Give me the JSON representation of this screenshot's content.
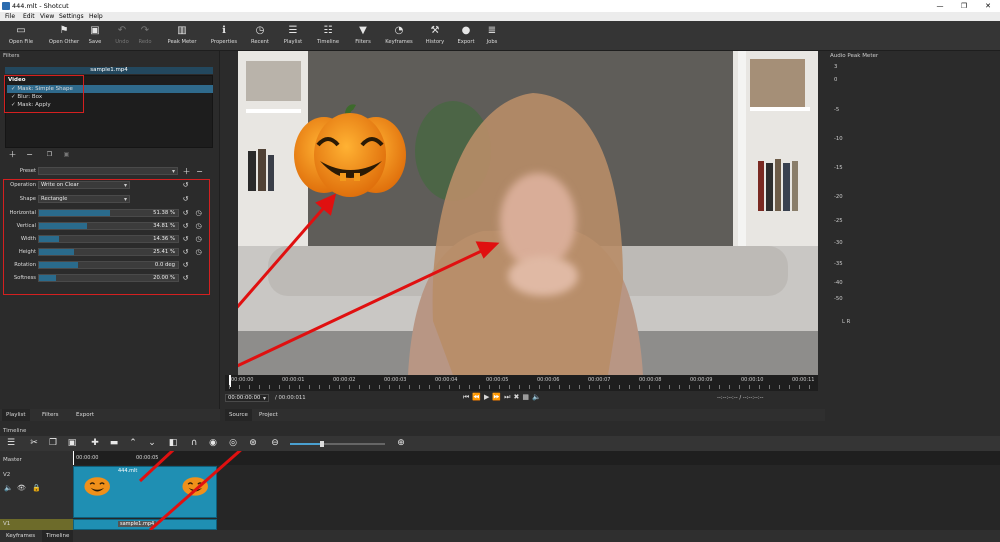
{
  "window": {
    "title": "444.mlt - Shotcut",
    "minimize": "—",
    "maximize": "❐",
    "close": "✕"
  },
  "menu": [
    "File",
    "Edit",
    "View",
    "Settings",
    "Help"
  ],
  "toolbar": [
    {
      "label": "Open File",
      "icon": "folder-open-icon",
      "glyph": "▭",
      "enabled": true
    },
    {
      "label": "Open Other",
      "icon": "open-other-icon",
      "glyph": "⚑",
      "enabled": true
    },
    {
      "label": "Save",
      "icon": "save-icon",
      "glyph": "▣",
      "enabled": true
    },
    {
      "label": "Undo",
      "icon": "undo-icon",
      "glyph": "↶",
      "enabled": false
    },
    {
      "label": "Redo",
      "icon": "redo-icon",
      "glyph": "↷",
      "enabled": false
    },
    {
      "label": "Peak Meter",
      "icon": "peak-meter-icon",
      "glyph": "▥",
      "enabled": true
    },
    {
      "label": "Properties",
      "icon": "info-icon",
      "glyph": "ℹ",
      "enabled": true
    },
    {
      "label": "Recent",
      "icon": "clock-icon",
      "glyph": "◷",
      "enabled": true
    },
    {
      "label": "Playlist",
      "icon": "playlist-icon",
      "glyph": "☰",
      "enabled": true
    },
    {
      "label": "Timeline",
      "icon": "timeline-icon",
      "glyph": "☷",
      "enabled": true
    },
    {
      "label": "Filters",
      "icon": "filter-icon",
      "glyph": "▼",
      "enabled": true
    },
    {
      "label": "Keyframes",
      "icon": "keyframes-icon",
      "glyph": "◔",
      "enabled": true
    },
    {
      "label": "History",
      "icon": "history-icon",
      "glyph": "⚒",
      "enabled": true
    },
    {
      "label": "Export",
      "icon": "export-icon",
      "glyph": "●",
      "enabled": true
    },
    {
      "label": "Jobs",
      "icon": "jobs-icon",
      "glyph": "≣",
      "enabled": true
    }
  ],
  "filters": {
    "header": "Filters",
    "clip_name": "sample1.mp4",
    "category": "Video",
    "items": [
      "Mask: Simple Shape",
      "Blur: Box",
      "Mask: Apply"
    ],
    "preset_label": "Preset",
    "params": {
      "operation_label": "Operation",
      "operation_value": "Write on Clear",
      "shape_label": "Shape",
      "shape_value": "Rectangle",
      "sliders": [
        {
          "label": "Horizontal",
          "value": "51.38 %",
          "fraction": 0.5138,
          "keyframe": true
        },
        {
          "label": "Vertical",
          "value": "34.81 %",
          "fraction": 0.3481,
          "keyframe": true
        },
        {
          "label": "Width",
          "value": "14.36 %",
          "fraction": 0.1436,
          "keyframe": true
        },
        {
          "label": "Height",
          "value": "25.41 %",
          "fraction": 0.2541,
          "keyframe": true
        },
        {
          "label": "Rotation",
          "value": "0.0 deg",
          "fraction": 0.28,
          "keyframe": false
        },
        {
          "label": "Softness",
          "value": "20.00 %",
          "fraction": 0.12,
          "keyframe": false
        }
      ]
    }
  },
  "left_tabs": [
    "Playlist",
    "Filters",
    "Export"
  ],
  "player": {
    "ruler": [
      "00:00:00",
      "00:00:01",
      "00:00:02",
      "00:00:03",
      "00:00:04",
      "00:00:05",
      "00:00:06",
      "00:00:07",
      "00:00:08",
      "00:00:09",
      "00:00:10",
      "00:00:11"
    ],
    "current_time": "00:00:00:00",
    "duration": "/ 00:00:0",
    "duration_tail": "11",
    "in_out": "--:--:--:-- /   --:--:--:--",
    "tabs": [
      "Source",
      "Project"
    ]
  },
  "meter": {
    "title": "Audio Peak Meter",
    "scale": [
      "3",
      "0",
      "-5",
      "-10",
      "-15",
      "-20",
      "-25",
      "-30",
      "-35",
      "-40",
      "-50"
    ],
    "lr": "L R"
  },
  "timeline": {
    "header": "Timeline",
    "master_label": "Master",
    "track_v2": "V2",
    "track_v1": "V1",
    "ruler_start": "00:00:00",
    "ruler_mid": "00:00:05",
    "clip_v2_name": "444.mlt",
    "clip_v1_name": "sample1.mp4"
  },
  "bottom_tabs": [
    "Keyframes",
    "Timeline"
  ],
  "colors": {
    "accent": "#2a6b8c",
    "highlight": "#d42020",
    "clip": "#1f8fb3"
  }
}
